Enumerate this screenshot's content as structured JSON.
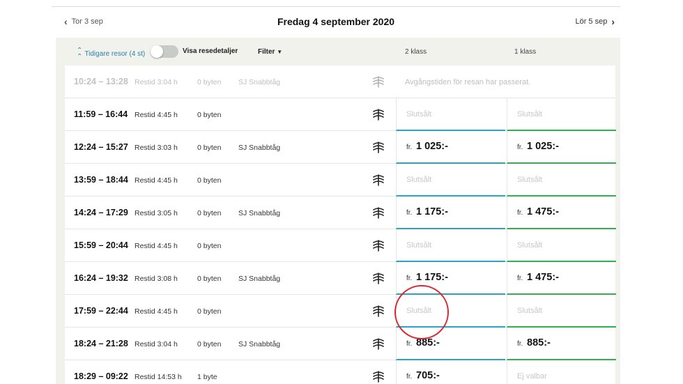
{
  "nav": {
    "prev_label": "Tor 3 sep",
    "next_label": "Lör 5 sep",
    "date_title": "Fredag 4 september 2020"
  },
  "controls": {
    "earlier_label": "Tidigare resor (4 st)",
    "details_label": "Visa resedetaljer",
    "details_toggle_on": false,
    "filter_label": "Filter",
    "class2_label": "2 klass",
    "class1_label": "1 klass"
  },
  "colors": {
    "class2_accent": "#2aa3c6",
    "class1_accent": "#2fb14f",
    "link": "#2a7fae",
    "annotation_circle": "#d9282f"
  },
  "past_row": {
    "time": "10:24 – 13:28",
    "duration": "Restid 3:04 h",
    "changes": "0 byten",
    "product": "SJ Snabbtåg",
    "message": "Avgångstiden för resan har passerat."
  },
  "rows": [
    {
      "time": "11:59 – 16:44",
      "duration": "Restid 4:45 h",
      "changes": "0 byten",
      "product": "",
      "p2_fr": "",
      "p2": "Slutsålt",
      "p2_available": false,
      "p1_fr": "",
      "p1": "Slutsålt",
      "p1_available": false
    },
    {
      "time": "12:24 – 15:27",
      "duration": "Restid 3:03 h",
      "changes": "0 byten",
      "product": "SJ Snabbtåg",
      "p2_fr": "fr.",
      "p2": "1 025:-",
      "p2_available": true,
      "p1_fr": "fr.",
      "p1": "1 025:-",
      "p1_available": true
    },
    {
      "time": "13:59 – 18:44",
      "duration": "Restid 4:45 h",
      "changes": "0 byten",
      "product": "",
      "p2_fr": "",
      "p2": "Slutsålt",
      "p2_available": false,
      "p1_fr": "",
      "p1": "Slutsålt",
      "p1_available": false
    },
    {
      "time": "14:24 – 17:29",
      "duration": "Restid 3:05 h",
      "changes": "0 byten",
      "product": "SJ Snabbtåg",
      "p2_fr": "fr.",
      "p2": "1 175:-",
      "p2_available": true,
      "p1_fr": "fr.",
      "p1": "1 475:-",
      "p1_available": true
    },
    {
      "time": "15:59 – 20:44",
      "duration": "Restid 4:45 h",
      "changes": "0 byten",
      "product": "",
      "p2_fr": "",
      "p2": "Slutsålt",
      "p2_available": false,
      "p1_fr": "",
      "p1": "Slutsålt",
      "p1_available": false
    },
    {
      "time": "16:24 – 19:32",
      "duration": "Restid 3:08 h",
      "changes": "0 byten",
      "product": "SJ Snabbtåg",
      "p2_fr": "fr.",
      "p2": "1 175:-",
      "p2_available": true,
      "p1_fr": "fr.",
      "p1": "1 475:-",
      "p1_available": true
    },
    {
      "time": "17:59 – 22:44",
      "duration": "Restid 4:45 h",
      "changes": "0 byten",
      "product": "",
      "p2_fr": "",
      "p2": "Slutsålt",
      "p2_available": false,
      "p1_fr": "",
      "p1": "Slutsålt",
      "p1_available": false
    },
    {
      "time": "18:24 – 21:28",
      "duration": "Restid 3:04 h",
      "changes": "0 byten",
      "product": "SJ Snabbtåg",
      "p2_fr": "fr.",
      "p2": "885:-",
      "p2_available": true,
      "p1_fr": "fr.",
      "p1": "885:-",
      "p1_available": true
    },
    {
      "time": "18:29 – 09:22",
      "duration": "Restid 14:53 h",
      "changes": "1 byte",
      "product": "",
      "p2_fr": "fr.",
      "p2": "705:-",
      "p2_available": true,
      "p1_fr": "",
      "p1": "Ej valbar",
      "p1_available": false
    }
  ]
}
